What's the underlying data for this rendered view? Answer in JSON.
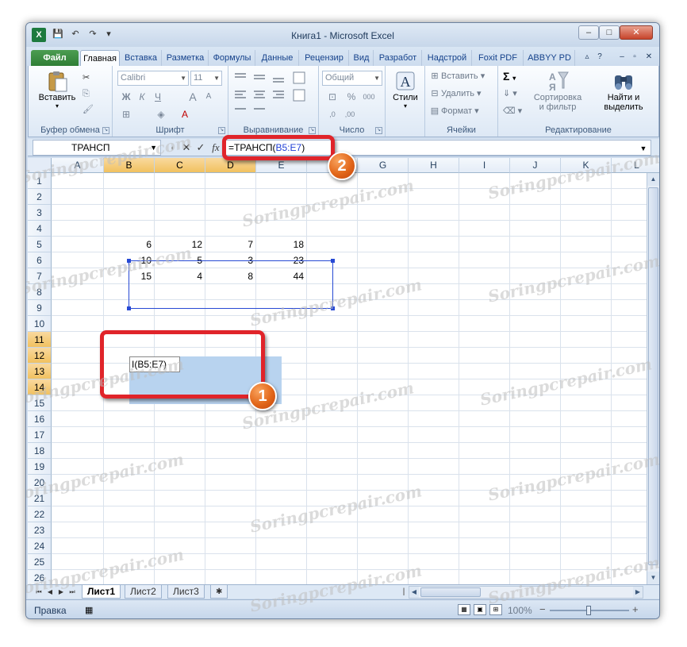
{
  "window": {
    "title": "Книга1 - Microsoft Excel",
    "app_icon": "X",
    "controls": {
      "minimize": "–",
      "maximize": "□",
      "close": "✕"
    }
  },
  "quick_access": {
    "icons": [
      "save-icon",
      "undo-icon",
      "redo-icon",
      "customize-icon"
    ],
    "glyphs": {
      "save": "💾",
      "undo": "↶",
      "redo": "↷",
      "customize": "▾"
    }
  },
  "tabs": [
    {
      "label": "Файл",
      "kind": "file"
    },
    {
      "label": "Главная",
      "kind": "active"
    },
    {
      "label": "Вставка"
    },
    {
      "label": "Разметка"
    },
    {
      "label": "Формулы"
    },
    {
      "label": "Данные"
    },
    {
      "label": "Рецензир"
    },
    {
      "label": "Вид"
    },
    {
      "label": "Разработ"
    },
    {
      "label": "Надстрой"
    },
    {
      "label": "Foxit PDF"
    },
    {
      "label": "ABBYY PD"
    }
  ],
  "ribbon": {
    "clipboard": {
      "paste_label": "Вставить",
      "group_label": "Буфер обмена",
      "cut": "✂",
      "copy": "⎘",
      "format_painter": "🖌"
    },
    "font": {
      "group_label": "Шрифт",
      "font_name": "Calibri",
      "font_size": "11",
      "bold": "Ж",
      "italic": "К",
      "underline": "Ч",
      "grow": "A",
      "shrink": "A",
      "borders": "⊞",
      "fill": "◈",
      "color": "A"
    },
    "alignment": {
      "group_label": "Выравнивание",
      "wrap": "⏎",
      "merge": "⊟"
    },
    "number": {
      "group_label": "Число",
      "format": "Общий",
      "percent": "%",
      "comma": "000",
      "currency": "⊡",
      "inc_decimal": ",0",
      "dec_decimal": ",00"
    },
    "styles": {
      "label": "Стили"
    },
    "cells": {
      "group_label": "Ячейки",
      "insert": "Вставить",
      "delete": "Удалить",
      "format": "Формат"
    },
    "editing": {
      "group_label": "Редактирование",
      "sum": "Σ",
      "fill": "⇓",
      "clear": "⌫",
      "sort_label_1": "Сортировка",
      "sort_label_2": "и фильтр",
      "find_label_1": "Найти и",
      "find_label_2": "выделить"
    }
  },
  "formula_bar": {
    "name_box": "ТРАНСП",
    "cancel": "✕",
    "enter": "✓",
    "fx": "fx",
    "formula_prefix": "=ТРАНСП(",
    "formula_ref": "B5:E7",
    "formula_suffix": ")"
  },
  "grid": {
    "columns": [
      "A",
      "B",
      "C",
      "D",
      "E",
      "F",
      "G",
      "H",
      "I",
      "J",
      "K",
      "L"
    ],
    "selected_columns": [
      "B",
      "C",
      "D"
    ],
    "rows": [
      "1",
      "2",
      "3",
      "4",
      "5",
      "6",
      "7",
      "8",
      "9",
      "10",
      "11",
      "12",
      "13",
      "14",
      "15",
      "16",
      "17",
      "18",
      "19",
      "20",
      "21",
      "22",
      "23",
      "24",
      "25",
      "26"
    ],
    "selected_rows": [
      "11",
      "12",
      "13",
      "14"
    ],
    "data": [
      {
        "row": "5",
        "values": [
          "6",
          "12",
          "7",
          "18"
        ]
      },
      {
        "row": "6",
        "values": [
          "10",
          "5",
          "3",
          "23"
        ]
      },
      {
        "row": "7",
        "values": [
          "15",
          "4",
          "8",
          "44"
        ]
      }
    ],
    "active_cell_text": "I(B5:E7)"
  },
  "callouts": {
    "one": "1",
    "two": "2"
  },
  "sheets": {
    "tabs": [
      "Лист1",
      "Лист2",
      "Лист3"
    ],
    "active": "Лист1",
    "nav": [
      "⏮",
      "◀",
      "▶",
      "⏭"
    ]
  },
  "status": {
    "mode": "Правка",
    "zoom": "100%",
    "zoom_minus": "−",
    "zoom_plus": "+"
  },
  "watermark": "Soringpcrepair.com",
  "colors": {
    "accent_red": "#e0242a",
    "badge_orange": "#e2671a",
    "ref_blue": "#1f3fd6",
    "selection_fill": "#b8d3ef"
  }
}
